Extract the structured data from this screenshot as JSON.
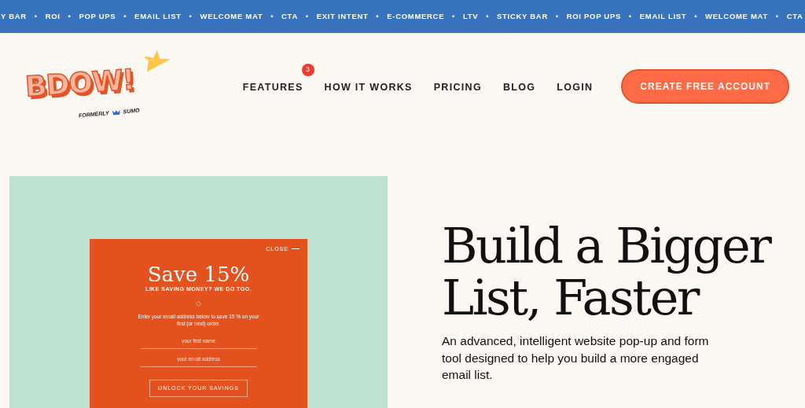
{
  "ticker": {
    "separator": "•",
    "items": [
      "Y BAR",
      "ROI",
      "POP UPS",
      "EMAIL LIST",
      "WELCOME MAT",
      "CTA",
      "EXIT INTENT",
      "E-COMMERCE",
      "LTV",
      "STICKY BAR",
      "ROI POP UPS",
      "EMAIL LIST",
      "WELCOME MAT",
      "CTA"
    ]
  },
  "logo": {
    "wordmark": "BDOW!",
    "formerly": "FORMERLY",
    "former_name": "SUMO"
  },
  "nav": [
    {
      "label": "FEATURES",
      "badge": "3"
    },
    {
      "label": "HOW IT WORKS"
    },
    {
      "label": "PRICING"
    },
    {
      "label": "BLOG"
    },
    {
      "label": "LOGIN"
    }
  ],
  "cta_button": "CREATE FREE ACCOUNT",
  "popup": {
    "close": "CLOSE",
    "title": "Save 15%",
    "subtitle": "LIKE SAVING MONEY? WE DO TOO.",
    "body": "Enter your email address below to save 15 % on your first (or next) order.",
    "fields": [
      {
        "placeholder": "your first name"
      },
      {
        "placeholder": "your email address"
      }
    ],
    "button": "UNLOCK YOUR SAVINGS"
  },
  "hero": {
    "heading_lines": [
      "Build a Bigger",
      "List, Faster"
    ],
    "description": "An advanced, intelligent website pop-up and form tool designed to help you build a more engaged email list."
  }
}
